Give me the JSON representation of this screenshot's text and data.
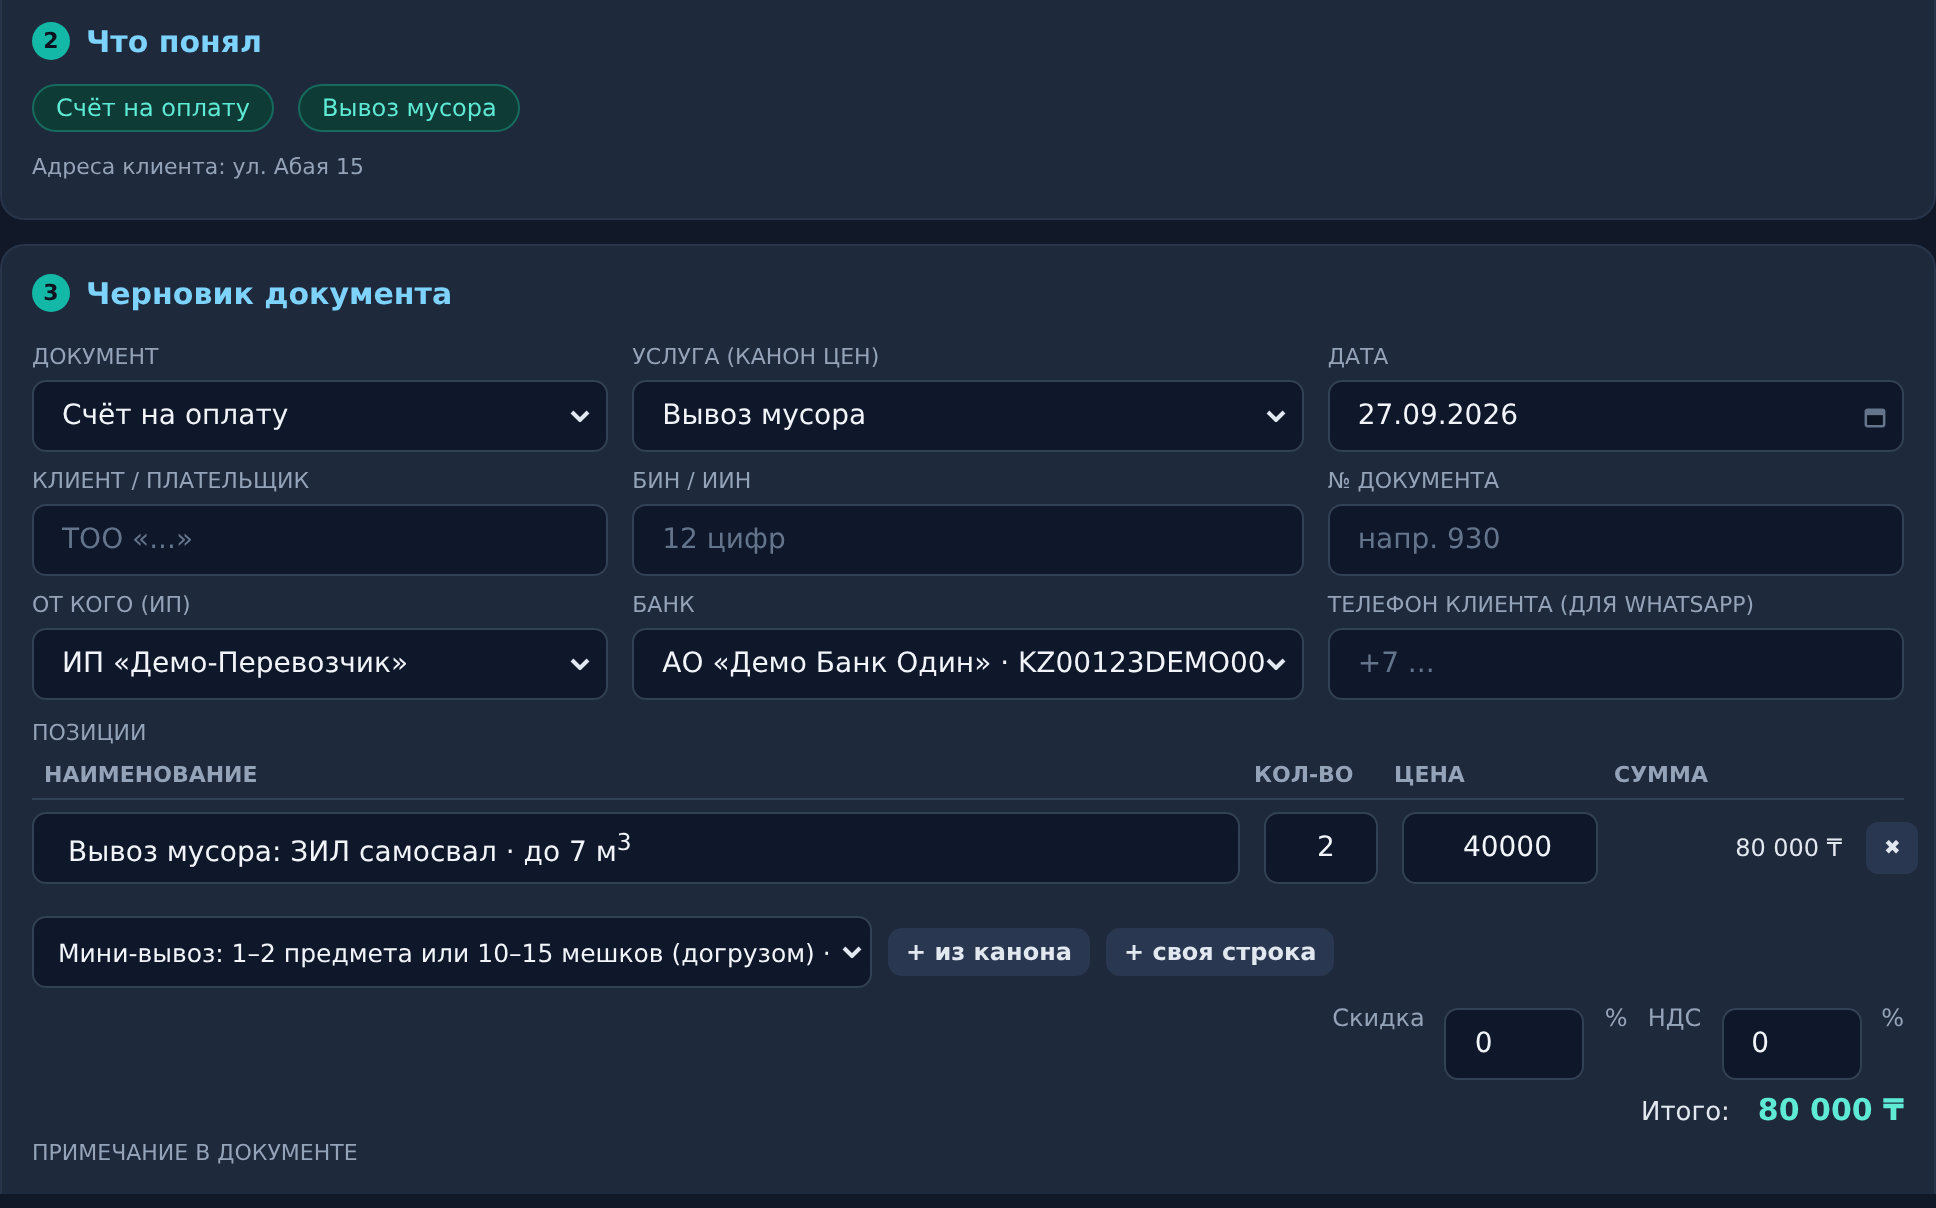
{
  "summary": {
    "step": "2",
    "title": "Что понял",
    "tags": [
      "Счёт на оплату",
      "Вывоз мусора"
    ],
    "address": "Адреса клиента: ул. Абая 15"
  },
  "draft": {
    "step": "3",
    "title": "Черновик документа",
    "fields": [
      {
        "label": "ДОКУМЕНТ",
        "kind": "select",
        "value": "Счёт на оплату"
      },
      {
        "label": "УСЛУГА (КАНОН ЦЕН)",
        "kind": "select",
        "value": "Вывоз мусора"
      },
      {
        "label": "ДАТА",
        "kind": "date",
        "value": "27.09.2026"
      },
      {
        "label": "КЛИЕНТ / ПЛАТЕЛЬЩИК",
        "kind": "input",
        "placeholder": "ТОО «...»"
      },
      {
        "label": "БИН / ИИН",
        "kind": "input",
        "placeholder": "12 цифр"
      },
      {
        "label": "№ ДОКУМЕНТА",
        "kind": "input",
        "placeholder": "напр. 930"
      },
      {
        "label": "ОТ КОГО (ИП)",
        "kind": "select",
        "value": "ИП «Демо-Перевозчик»"
      },
      {
        "label": "БАНК",
        "kind": "select",
        "value": "АО «Демо Банк Один» · KZ00123DEMO00"
      },
      {
        "label": "ТЕЛЕФОН КЛИЕНТА (ДЛЯ WHATSAPP)",
        "kind": "input",
        "placeholder": "+7 ..."
      }
    ],
    "positions_label": "ПОЗИЦИИ",
    "columns": [
      "НАИМЕНОВАНИЕ",
      "КОЛ-ВО",
      "ЦЕНА",
      "СУММА"
    ],
    "rows": [
      {
        "name": "Вывоз мусора: ЗИЛ самосвал · до 7 м$^{3}$",
        "qty": "2",
        "price": "40000",
        "sum": "80 000 ₸",
        "delete": "✖"
      }
    ],
    "template_select": {
      "value": "Мини-вывоз: 1–2 предмета или 10–15 мешков (догрузом) ·"
    },
    "buttons": [
      "+ из канона",
      "+ своя строка"
    ],
    "discount": {
      "label": "Скидка",
      "value": "0",
      "unit": "%"
    },
    "vat": {
      "label": "НДС",
      "value": "0",
      "unit": "%"
    },
    "total": {
      "label": "Итого:",
      "value": "80 000 ₸"
    },
    "note_label": "ПРИМЕЧАНИЕ В ДОКУМЕНТЕ"
  }
}
